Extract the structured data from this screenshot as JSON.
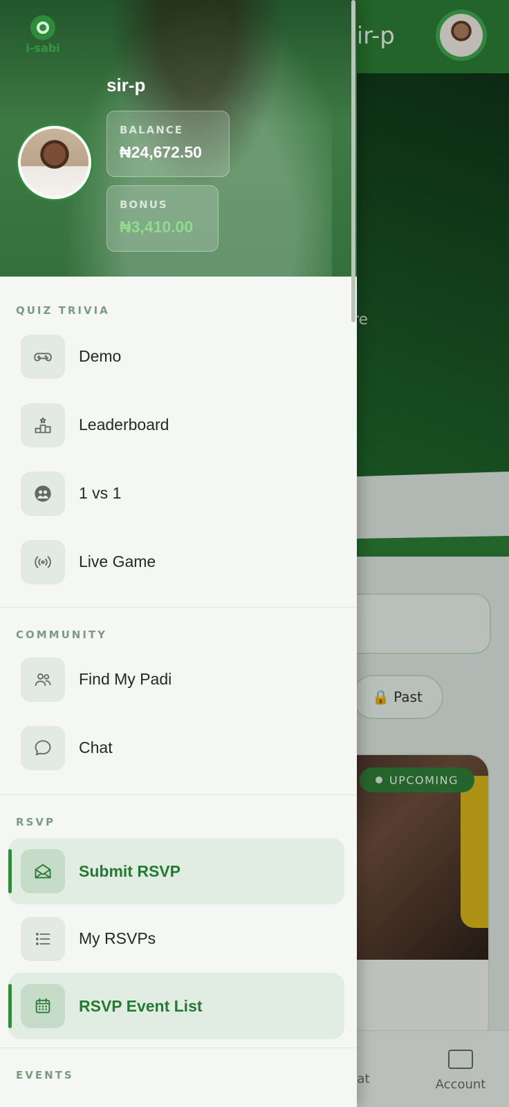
{
  "background": {
    "app_title": "sir-p",
    "filter_past_label": "Past",
    "event_badge": "UPCOMING",
    "hero_text": "re",
    "bottom_nav": {
      "chat_label": "hat",
      "account_label": "Account"
    }
  },
  "drawer": {
    "brand_text": "i-sabi",
    "username": "sir-p",
    "balance": {
      "label": "BALANCE",
      "value": "₦24,672.50"
    },
    "bonus": {
      "label": "BONUS",
      "value": "₦3,410.00"
    },
    "sections": [
      {
        "title": "QUIZ TRIVIA",
        "items": [
          {
            "label": "Demo",
            "icon": "gamepad-icon"
          },
          {
            "label": "Leaderboard",
            "icon": "podium-icon"
          },
          {
            "label": "1 vs 1",
            "icon": "versus-icon"
          },
          {
            "label": "Live Game",
            "icon": "broadcast-icon"
          }
        ]
      },
      {
        "title": "COMMUNITY",
        "items": [
          {
            "label": "Find My Padi",
            "icon": "people-icon"
          },
          {
            "label": "Chat",
            "icon": "chat-bubble-icon"
          }
        ]
      },
      {
        "title": "RSVP",
        "items": [
          {
            "label": "Submit RSVP",
            "icon": "envelope-icon",
            "active": true
          },
          {
            "label": "My RSVPs",
            "icon": "list-icon"
          },
          {
            "label": "RSVP Event List",
            "icon": "calendar-icon",
            "active": true
          }
        ]
      },
      {
        "title": "EVENTS",
        "items": []
      }
    ]
  },
  "colors": {
    "accent": "#2f8c3c",
    "active_bg": "#e1ece2",
    "section_title": "#7d9a82"
  }
}
